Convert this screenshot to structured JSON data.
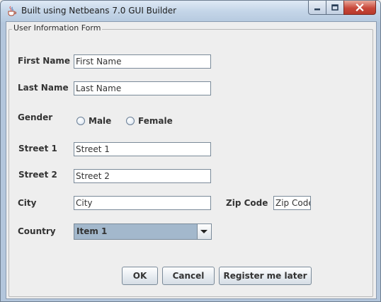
{
  "window": {
    "title": "Built using Netbeans 7.0 GUI Builder"
  },
  "form": {
    "legend": "User Information Form",
    "first_name": {
      "label": "First Name",
      "value": "First Name"
    },
    "last_name": {
      "label": "Last Name",
      "value": "Last Name"
    },
    "gender": {
      "label": "Gender",
      "options": [
        "Male",
        "Female"
      ],
      "selected": null
    },
    "street1": {
      "label": "Street 1",
      "value": "Street 1"
    },
    "street2": {
      "label": "Street 2",
      "value": "Street 2"
    },
    "city": {
      "label": "City",
      "value": "City"
    },
    "zip": {
      "label": "Zip Code",
      "value": "Zip Code"
    },
    "country": {
      "label": "Country",
      "selected": "Item 1"
    }
  },
  "buttons": {
    "ok": "OK",
    "cancel": "Cancel",
    "register_later": "Register me later"
  },
  "icons": {
    "app": "java-cup-icon",
    "minimize": "minimize-icon",
    "maximize": "maximize-icon",
    "close": "close-icon",
    "dropdown": "chevron-down-icon"
  }
}
